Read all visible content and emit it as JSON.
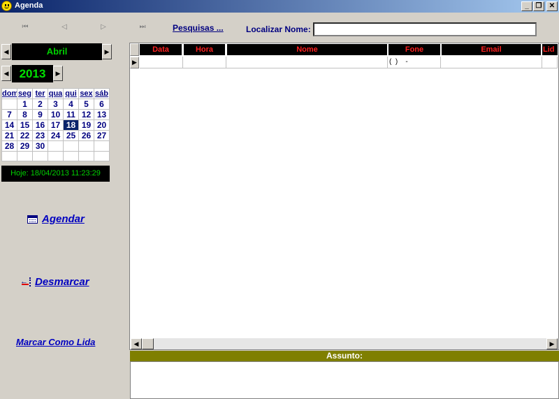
{
  "window": {
    "title": "Agenda"
  },
  "toolbar": {
    "first": "⏮",
    "prev": "◁",
    "next": "▷",
    "last": "⏭",
    "pesquisas": "Pesquisas ...",
    "localizar_label": "Localizar Nome:",
    "localizar_value": ""
  },
  "calendar": {
    "month": "Abril",
    "year": "2013",
    "weekdays": [
      "dom",
      "seg",
      "ter",
      "qua",
      "qui",
      "sex",
      "sáb"
    ],
    "weeks": [
      [
        "",
        "1",
        "2",
        "3",
        "4",
        "5",
        "6"
      ],
      [
        "7",
        "8",
        "9",
        "10",
        "11",
        "12",
        "13"
      ],
      [
        "14",
        "15",
        "16",
        "17",
        "18",
        "19",
        "20"
      ],
      [
        "21",
        "22",
        "23",
        "24",
        "25",
        "26",
        "27"
      ],
      [
        "28",
        "29",
        "30",
        "",
        "",
        "",
        ""
      ],
      [
        "",
        "",
        "",
        "",
        "",
        "",
        ""
      ]
    ],
    "selected_day": "18",
    "today_text": "Hoje: 18/04/2013 11:23:29"
  },
  "actions": {
    "agendar": "Agendar",
    "desmarcar": "Desmarcar",
    "marcar": "Marcar Como Lida"
  },
  "grid": {
    "columns": [
      "Data",
      "Hora",
      "Nome",
      "Fone",
      "Email",
      "Lid"
    ],
    "row": {
      "data": "",
      "hora": "",
      "nome": "",
      "fone": "(  )    -",
      "email": "",
      "lid": ""
    }
  },
  "assunto": {
    "label": "Assunto:",
    "value": ""
  }
}
